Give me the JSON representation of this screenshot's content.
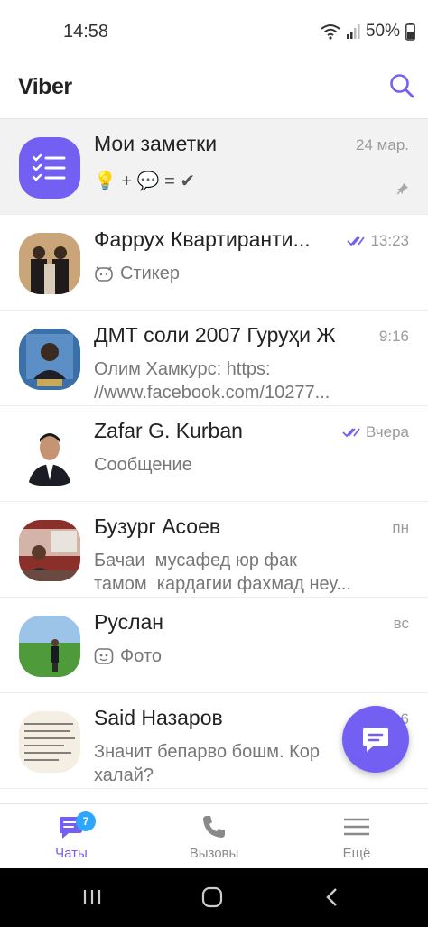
{
  "status_bar": {
    "time": "14:58",
    "battery": "50%"
  },
  "header": {
    "title": "Viber"
  },
  "chats": [
    {
      "name": "Мои заметки",
      "time": "24 мар.",
      "preview_emoji": "💡 + 💬 = ✔",
      "pinned": true
    },
    {
      "name": "Фаррух Квартиранти...",
      "time": "13:23",
      "read": true,
      "preview": "Стикер",
      "preview_icon": "sticker-icon"
    },
    {
      "name": "ДМТ соли 2007 Гуруҳи Ж",
      "time": "9:16",
      "preview_line1": "Олим Хамкурс: https:",
      "preview_line2": "//www.facebook.com/10277..."
    },
    {
      "name": "Zafar G. Kurban",
      "time": "Вчера",
      "read": true,
      "preview": "Сообщение"
    },
    {
      "name": "Бузург Асоев",
      "time": "пн",
      "preview_line1": "Бачаи  мусафед юр фак",
      "preview_line2": "тамом  кардагии фахмад неу..."
    },
    {
      "name": "Руслан",
      "time": "вс",
      "preview": "Фото",
      "preview_icon": "photo-icon"
    },
    {
      "name": "Said Назаров",
      "time": "6",
      "preview_line1": "Значит бепарво бошм. Кор",
      "preview_line2": "халай?"
    }
  ],
  "bottom_nav": [
    {
      "label": "Чаты",
      "badge": "7",
      "active": true
    },
    {
      "label": "Вызовы"
    },
    {
      "label": "Ещё"
    }
  ],
  "colors": {
    "accent": "#7360f2",
    "badge": "#2ea6ff"
  }
}
